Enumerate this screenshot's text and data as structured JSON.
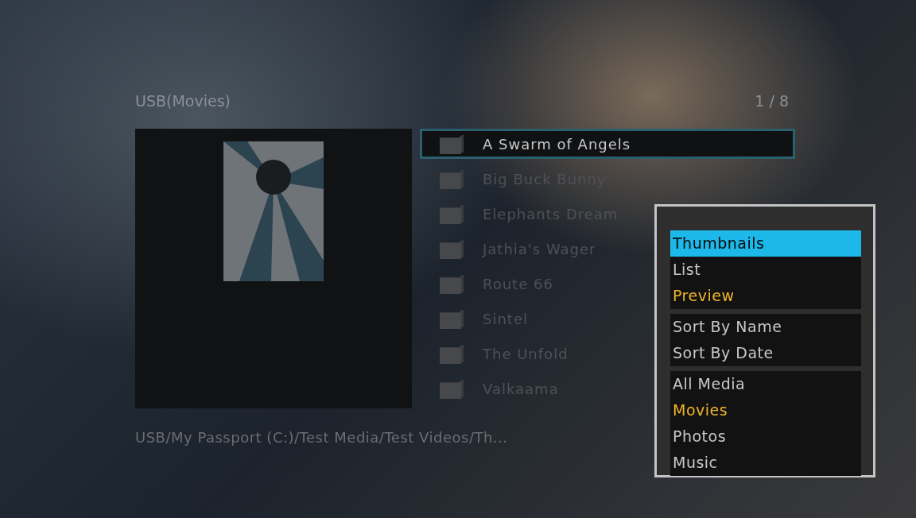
{
  "header": {
    "title": "USB(Movies)",
    "counter": "1 / 8"
  },
  "files": [
    {
      "name": "A Swarm of Angels",
      "selected": true
    },
    {
      "name": "Big Buck Bunny",
      "selected": false
    },
    {
      "name": "Elephants Dream",
      "selected": false
    },
    {
      "name": "Jathia's Wager",
      "selected": false
    },
    {
      "name": "Route 66",
      "selected": false
    },
    {
      "name": "Sintel",
      "selected": false
    },
    {
      "name": "The Unfold",
      "selected": false
    },
    {
      "name": "Valkaama",
      "selected": false
    }
  ],
  "path": "USB/My Passport (C:)/Test Media/Test Videos/Th...",
  "menu": {
    "groups": [
      [
        {
          "label": "Thumbnails",
          "selected": true,
          "active": false
        },
        {
          "label": "List",
          "selected": false,
          "active": false
        },
        {
          "label": "Preview",
          "selected": false,
          "active": true
        }
      ],
      [
        {
          "label": "Sort By Name",
          "selected": false,
          "active": false
        },
        {
          "label": "Sort By Date",
          "selected": false,
          "active": false
        }
      ],
      [
        {
          "label": "All Media",
          "selected": false,
          "active": false
        },
        {
          "label": "Movies",
          "selected": false,
          "active": true
        },
        {
          "label": "Photos",
          "selected": false,
          "active": false
        },
        {
          "label": "Music",
          "selected": false,
          "active": false
        }
      ]
    ]
  }
}
